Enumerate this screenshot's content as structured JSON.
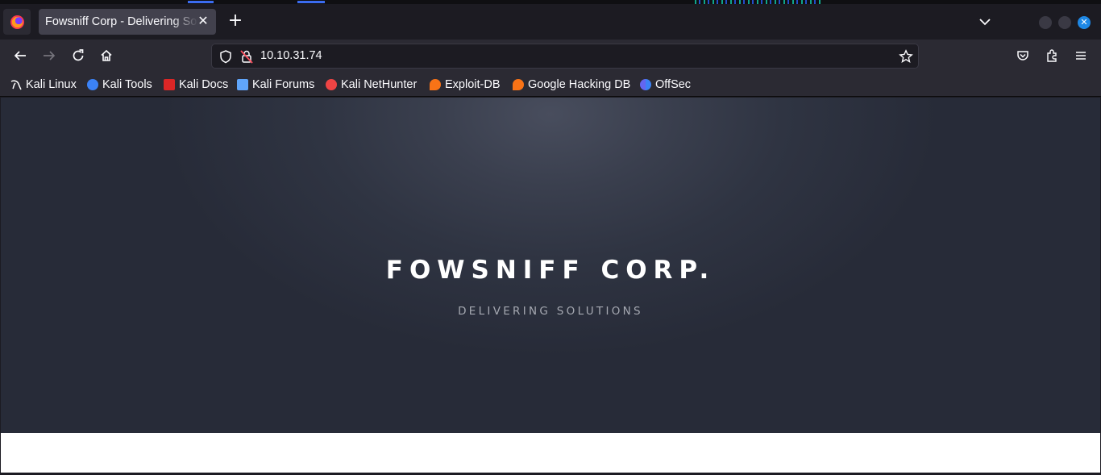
{
  "browser": {
    "tab": {
      "title": "Fowsniff Corp - Delivering Solutions",
      "close_icon": "close-icon"
    },
    "new_tab_icon": "plus-icon",
    "url": "10.10.31.74",
    "bookmarks": [
      {
        "label": "Kali Linux",
        "icon": "kali-dragon-icon",
        "color": "#ffffff"
      },
      {
        "label": "Kali Tools",
        "icon": "kali-tools-icon",
        "color": "#3b82f6"
      },
      {
        "label": "Kali Docs",
        "icon": "kali-docs-icon",
        "color": "#dc2626"
      },
      {
        "label": "Kali Forums",
        "icon": "kali-forums-icon",
        "color": "#60a5fa"
      },
      {
        "label": "Kali NetHunter",
        "icon": "nethunter-icon",
        "color": "#ef4444"
      },
      {
        "label": "Exploit-DB",
        "icon": "exploit-db-icon",
        "color": "#f97316"
      },
      {
        "label": "Google Hacking DB",
        "icon": "ghdb-icon",
        "color": "#f97316"
      },
      {
        "label": "OffSec",
        "icon": "offsec-icon",
        "color": "#6366f1"
      }
    ]
  },
  "page": {
    "title": "FOWSNIFF CORP.",
    "subtitle": "DELIVERING SOLUTIONS"
  }
}
